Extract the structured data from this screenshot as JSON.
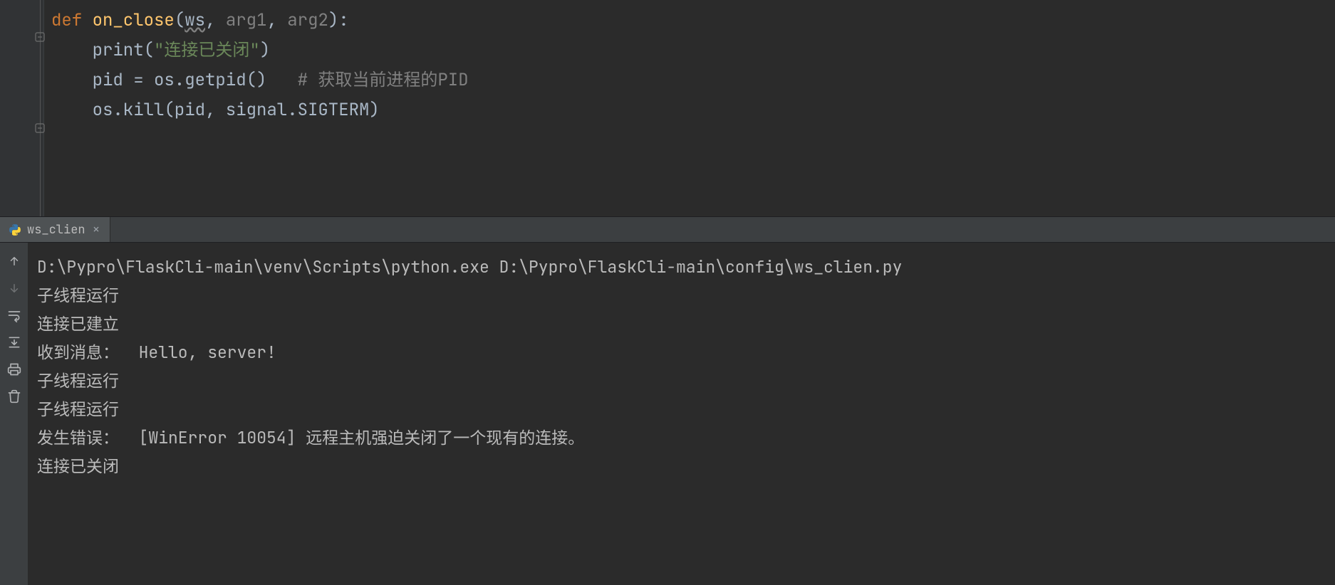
{
  "editor": {
    "lines": [
      {
        "indent": 0,
        "tokens": [
          {
            "cls": "kw",
            "t": "def "
          },
          {
            "cls": "fn",
            "t": "on_close"
          },
          {
            "cls": "plain",
            "t": "("
          },
          {
            "cls": "paramUsed",
            "t": "ws"
          },
          {
            "cls": "plain",
            "t": ", "
          },
          {
            "cls": "param",
            "t": "arg1"
          },
          {
            "cls": "plain",
            "t": ", "
          },
          {
            "cls": "param",
            "t": "arg2"
          },
          {
            "cls": "plain",
            "t": "):"
          }
        ]
      },
      {
        "indent": 1,
        "tokens": [
          {
            "cls": "plain",
            "t": "print("
          },
          {
            "cls": "str",
            "t": "\"连接已关闭\""
          },
          {
            "cls": "plain",
            "t": ")"
          }
        ]
      },
      {
        "indent": 1,
        "tokens": [
          {
            "cls": "plain",
            "t": "pid = os.getpid()   "
          },
          {
            "cls": "cm",
            "t": "# 获取当前进程的PID"
          }
        ]
      },
      {
        "indent": 1,
        "tokens": [
          {
            "cls": "plain",
            "t": "os.kill(pid, signal.SIGTERM)"
          }
        ]
      }
    ]
  },
  "run": {
    "tabLabel": "ws_clien",
    "output": [
      "D:\\Pypro\\FlaskCli-main\\venv\\Scripts\\python.exe D:\\Pypro\\FlaskCli-main\\config\\ws_clien.py",
      "子线程运行",
      "连接已建立",
      "收到消息：  Hello, server!",
      "子线程运行",
      "子线程运行",
      "发生错误：  [WinError 10054] 远程主机强迫关闭了一个现有的连接。",
      "连接已关闭"
    ]
  },
  "icons": {
    "tab_close": "×"
  }
}
